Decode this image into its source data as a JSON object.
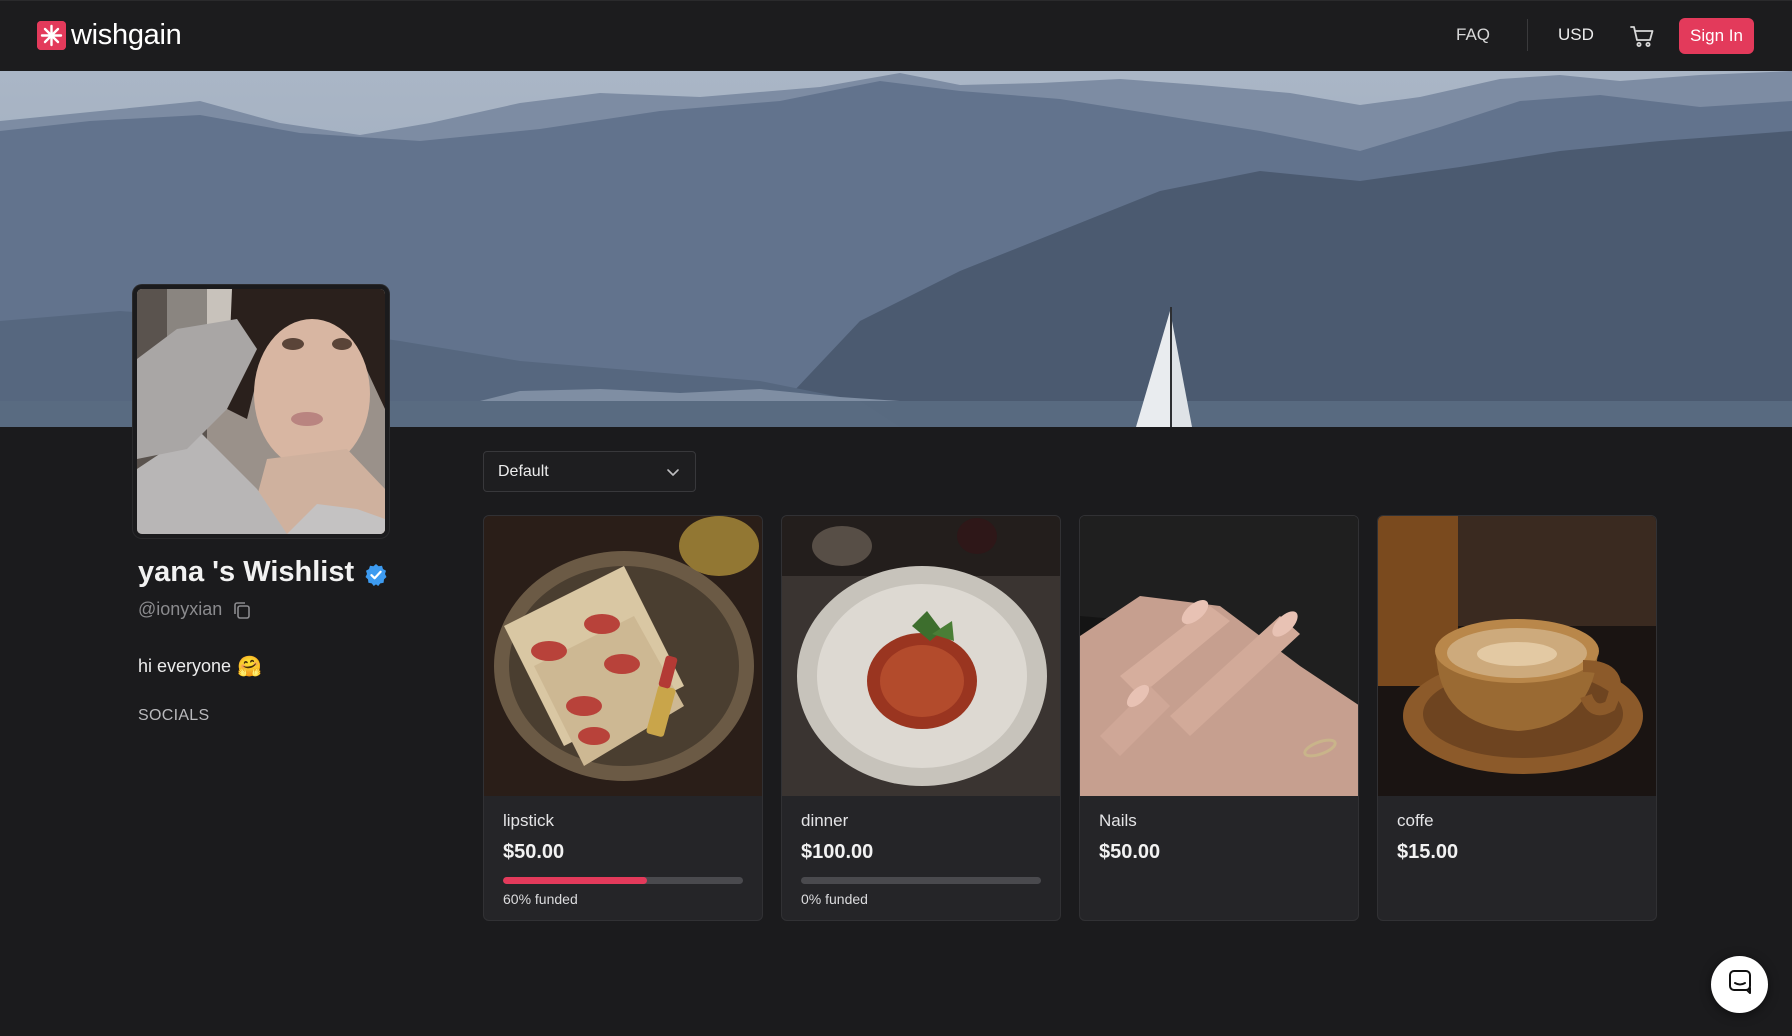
{
  "brand": {
    "name": "wishgain",
    "accent": "#e33a5b"
  },
  "nav": {
    "faq": "FAQ",
    "currency": "USD",
    "signin": "Sign In"
  },
  "profile": {
    "name": "yana 's Wishlist",
    "handle": "@ionyxian",
    "bio": "hi everyone",
    "bio_emoji": "🤗",
    "socials_label": "SOCIALS"
  },
  "sort": {
    "value": "Default"
  },
  "items": [
    {
      "title": "lipstick",
      "price": "$50.00",
      "funded_fraction": 0.6,
      "funded_text": "60% funded",
      "icon": "lipstick-photo"
    },
    {
      "title": "dinner",
      "price": "$100.00",
      "funded_fraction": 0.0,
      "funded_text": "0% funded",
      "icon": "pasta-photo"
    },
    {
      "title": "Nails",
      "price": "$50.00",
      "icon": "nails-photo"
    },
    {
      "title": "coffe",
      "price": "$15.00",
      "icon": "coffee-photo"
    }
  ]
}
